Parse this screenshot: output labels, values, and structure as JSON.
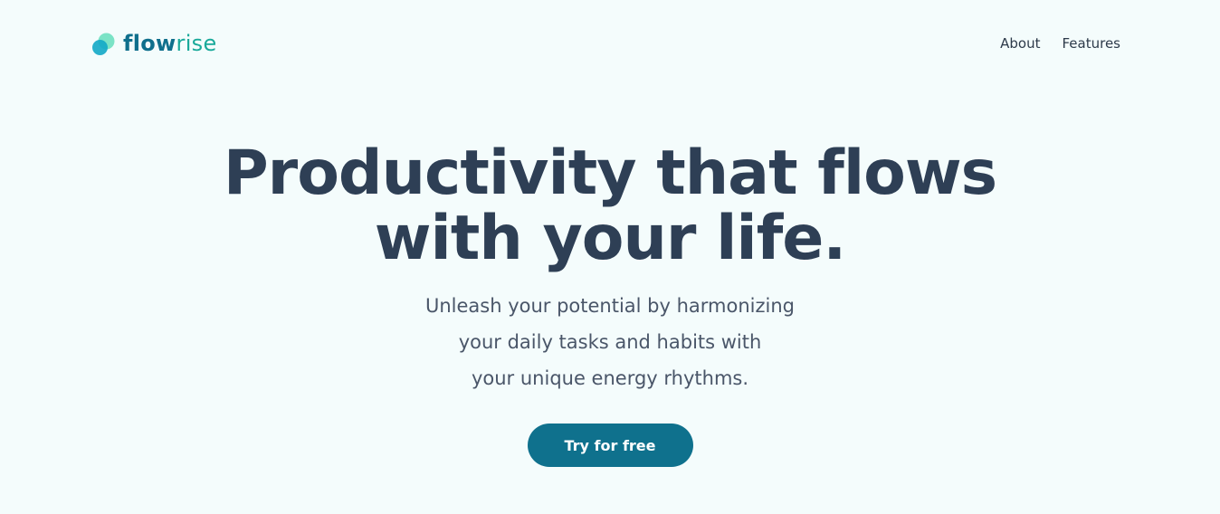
{
  "brand": {
    "name_part1": "flow",
    "name_part2": "rise",
    "logo_icon": "two-overlapping-circles-icon",
    "colors": {
      "flow": "#0f6f8c",
      "rise": "#19a99a",
      "circle_back": "#6ee0c0",
      "circle_front": "#13a9c7"
    }
  },
  "nav": {
    "items": [
      {
        "label": "About"
      },
      {
        "label": "Features"
      }
    ]
  },
  "hero": {
    "title_line1": "Productivity that flows",
    "title_line2": "with your life.",
    "subtitle_line1": "Unleash your potential by harmonizing",
    "subtitle_line2": "your daily tasks and habits with",
    "subtitle_line3": "your unique energy rhythms.",
    "cta_label": "Try for free"
  },
  "colors": {
    "background": "#f4fcfc",
    "heading": "#2e3f55",
    "body_text": "#4a5669",
    "cta_bg": "#0f718d",
    "cta_text": "#ffffff"
  }
}
